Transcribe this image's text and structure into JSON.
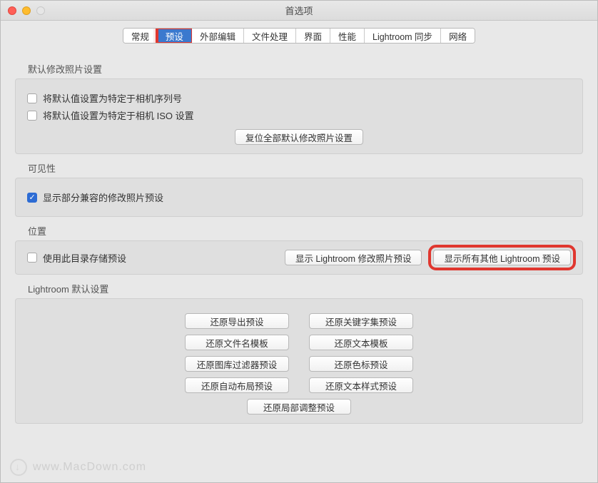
{
  "window": {
    "title": "首选项"
  },
  "tabs": [
    "常规",
    "预设",
    "外部编辑",
    "文件处理",
    "界面",
    "性能",
    "Lightroom 同步",
    "网络"
  ],
  "active_tab_index": 1,
  "sections": {
    "defaults_edit": {
      "title": "默认修改照片设置",
      "camera_serial": {
        "label": "将默认值设置为特定于相机序列号",
        "checked": false
      },
      "camera_iso": {
        "label": "将默认值设置为特定于相机 ISO 设置",
        "checked": false
      },
      "reset_all": "复位全部默认修改照片设置"
    },
    "visibility": {
      "title": "可见性",
      "show_partial": {
        "label": "显示部分兼容的修改照片预设",
        "checked": true
      }
    },
    "location": {
      "title": "位置",
      "store_with_catalog": {
        "label": "使用此目录存储预设",
        "checked": false
      },
      "show_develop": "显示 Lightroom 修改照片预设",
      "show_all_other": "显示所有其他 Lightroom 预设"
    },
    "lr_defaults": {
      "title": "Lightroom 默认设置",
      "restore_export": "还原导出预设",
      "restore_keyword": "还原关键字集预设",
      "restore_filename": "还原文件名模板",
      "restore_text_template": "还原文本模板",
      "restore_library_filter": "还原图库过滤器预设",
      "restore_color_label": "还原色标预设",
      "restore_auto_layout": "还原自动布局预设",
      "restore_text_style": "还原文本样式预设",
      "restore_local_adjust": "还原局部调整预设"
    }
  },
  "watermark": "www.MacDown.com"
}
